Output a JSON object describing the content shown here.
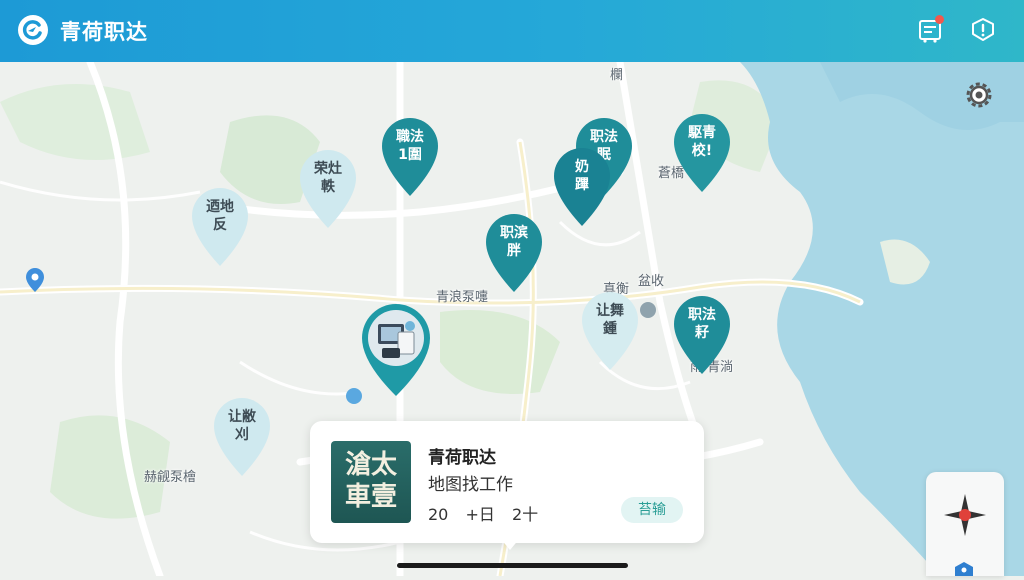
{
  "app": {
    "title": "青荷职达"
  },
  "header": {
    "cart_icon": "cart-icon",
    "bell_icon": "bell-icon",
    "notification_dot": true
  },
  "colors": {
    "accent": "#25a8d8",
    "pin_dark": "#1f8d99",
    "pin_light": "#cfe9ef",
    "tag_text": "#2a9e96"
  },
  "map": {
    "labels": [
      {
        "text": "青浪泵嚏"
      },
      {
        "text": "真衡"
      },
      {
        "text": "盆收"
      },
      {
        "text": "蒼橋"
      },
      {
        "text": "雨 青淌"
      },
      {
        "text": "赫觎泵檜"
      },
      {
        "text": "欄"
      }
    ],
    "pins": [
      {
        "text": "職法\n1圍",
        "style": "dark"
      },
      {
        "text": "职法\n眠",
        "style": "dark"
      },
      {
        "text": "奶\n蹕",
        "style": "dark"
      },
      {
        "text": "駆青\n校!",
        "style": "dark"
      },
      {
        "text": "职滨\n胖",
        "style": "dark"
      },
      {
        "text": "职法\n耔",
        "style": "dark"
      },
      {
        "text": "荣灶\n軼",
        "style": "light"
      },
      {
        "text": "迺地\n反",
        "style": "light"
      },
      {
        "text": "让舞\n鍾",
        "style": "light"
      },
      {
        "text": "让敝\n刈",
        "style": "light"
      }
    ]
  },
  "card": {
    "thumb_text": "滄太\n車壹",
    "title": "青荷职达",
    "subtitle": "地图找工作",
    "stat_1": "20",
    "stat_2": "+日",
    "stat_3": "2十",
    "tag": "苔输"
  },
  "controls": {
    "settings_icon": "gear-icon",
    "compass_icon": "compass-icon",
    "locate_icon": "locate-icon"
  }
}
